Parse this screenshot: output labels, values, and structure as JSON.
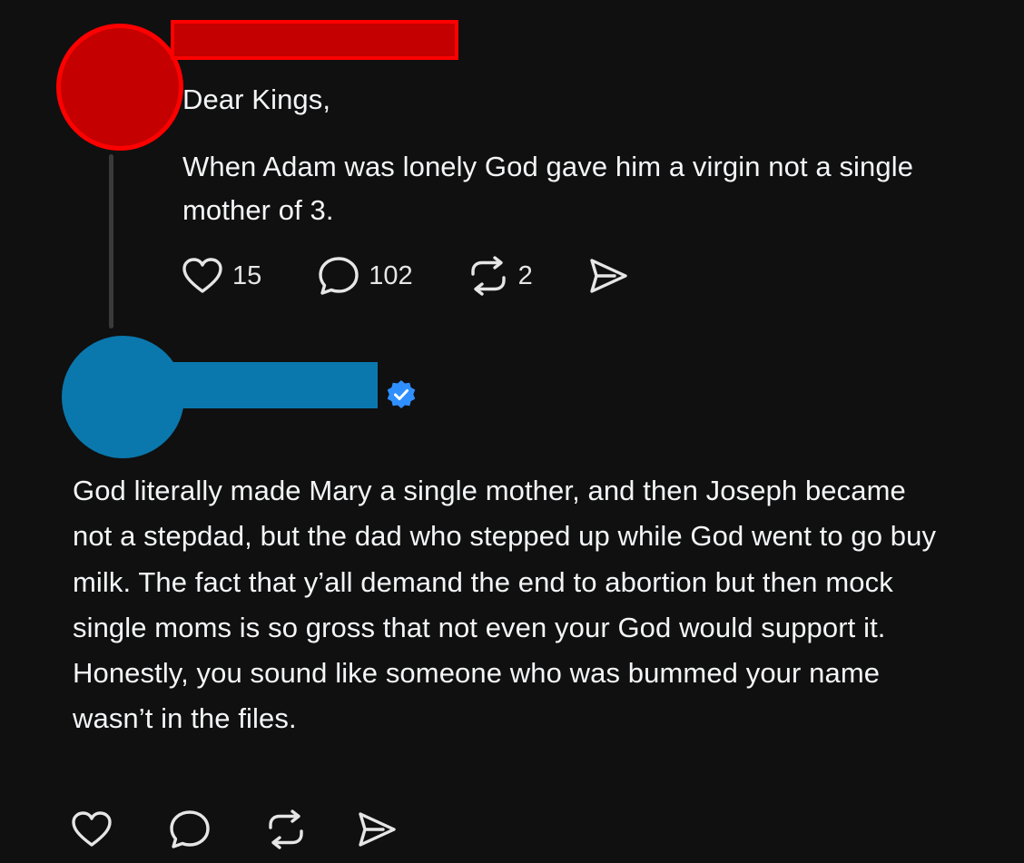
{
  "post": {
    "greeting": "Dear Kings,",
    "body": "When Adam was lonely God gave him a virgin not a single mother of 3.",
    "likes": "15",
    "replies": "102",
    "reposts": "2"
  },
  "reply": {
    "verified": true,
    "body": "God literally made Mary a single mother, and then Joseph became not a stepdad, but the dad who stepped up while God went to go buy milk. The fact that y’all demand the end to abortion but then mock single moms is so gross that not even your God would support it. Honestly, you sound like someone who was bummed your name wasn’t in the files."
  },
  "icons": {
    "like": "heart-icon",
    "reply": "comment-bubble-icon",
    "repost": "repost-arrows-icon",
    "share": "send-icon",
    "verified": "verified-badge-icon"
  },
  "colors": {
    "background": "#101010",
    "text": "#f3f5f7",
    "redaction_red": "#c40000",
    "redaction_red_border": "#ff0000",
    "redaction_blue": "#0a78ad",
    "verified_blue": "#2f8fff",
    "thread_line": "#3a3a3a"
  }
}
